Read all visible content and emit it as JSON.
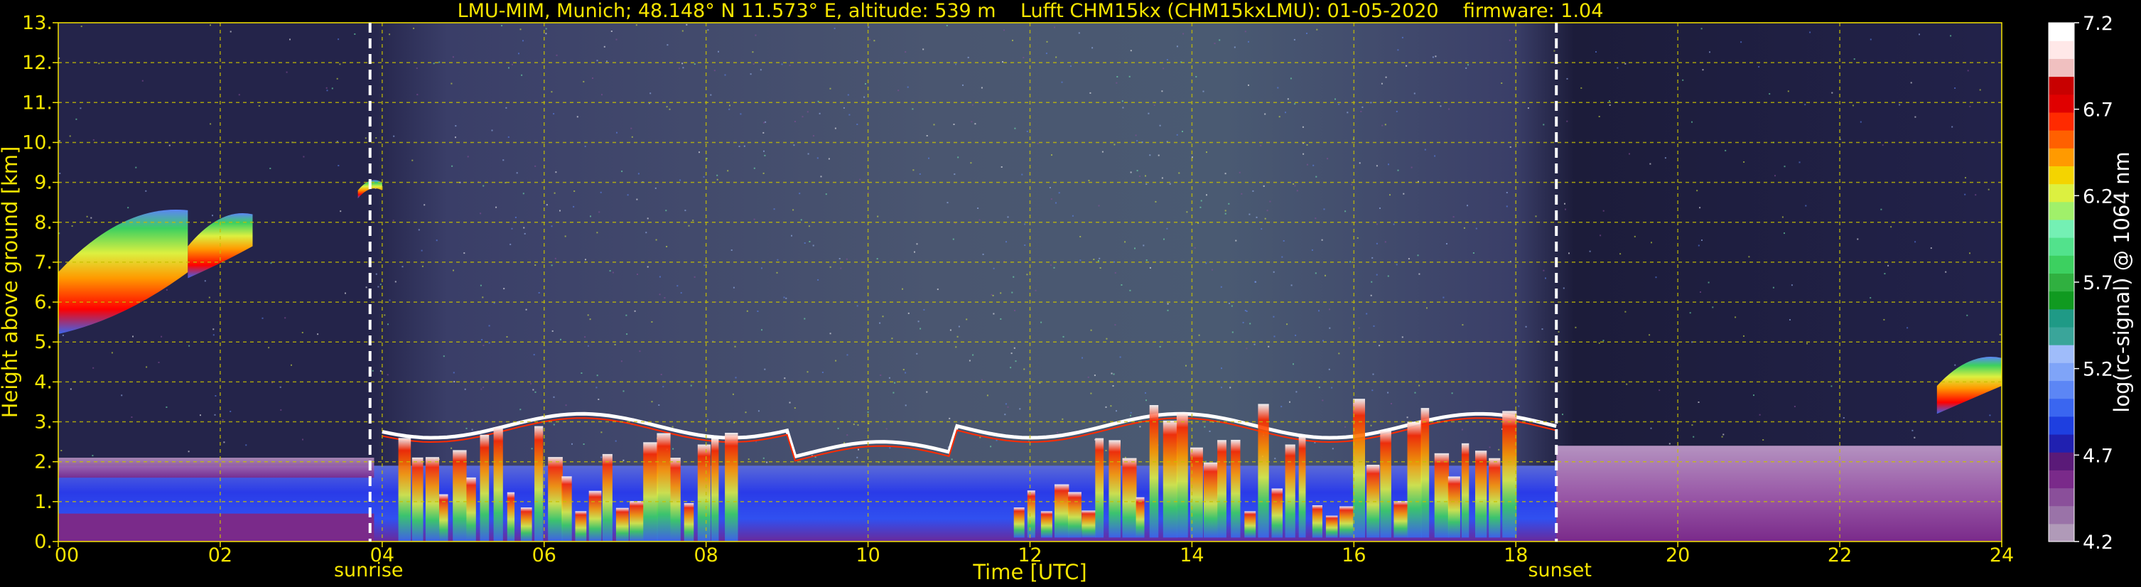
{
  "chart_data": {
    "type": "heatmap",
    "title": "LMU-MIM, Munich; 48.148° N 11.573° E, altitude: 539 m    Lufft CHM15kx (CHM15kxLMU): 01-05-2020    firmware: 1.04",
    "xlabel": "Time [UTC]",
    "ylabel": "Height above ground [km]",
    "xlim": [
      0,
      24
    ],
    "ylim": [
      0,
      13
    ],
    "x_ticks": [
      "00",
      "02",
      "04",
      "06",
      "08",
      "10",
      "12",
      "14",
      "16",
      "18",
      "20",
      "22",
      "24"
    ],
    "y_ticks": [
      "0.",
      "1.",
      "2.",
      "3.",
      "4.",
      "5.",
      "6.",
      "7.",
      "8.",
      "9.",
      "10.",
      "11.",
      "12.",
      "13."
    ],
    "grid": true,
    "markers": [
      {
        "label": "sunrise",
        "time": 3.85
      },
      {
        "label": "sunset",
        "time": 18.5
      }
    ],
    "colorbar": {
      "label": "log(rc-signal) @ 1064 nm",
      "range": [
        4.2,
        7.2
      ],
      "tick_labels": [
        "7.2",
        "6.7",
        "6.2",
        "5.7",
        "5.2",
        "4.7",
        "4.2"
      ],
      "colors": [
        "#b09ab8",
        "#9a73a8",
        "#8a4f9a",
        "#7a2a8a",
        "#5a1a78",
        "#2020b0",
        "#1e3fe0",
        "#3a66f0",
        "#5c86f5",
        "#7fa4f8",
        "#9fbcfa",
        "#3aa59a",
        "#1f9a86",
        "#109a20",
        "#30b040",
        "#3cd060",
        "#52e28c",
        "#74f0b4",
        "#a0f06a",
        "#dcf040",
        "#f4d400",
        "#ff9a00",
        "#ff6000",
        "#ff2a00",
        "#e00000",
        "#c80000",
        "#f0c0c0",
        "#ffe8e8",
        "#ffffff"
      ]
    },
    "features": [
      {
        "kind": "aerosol_layer",
        "t_start": 0.0,
        "t_end": 24.0,
        "bottom_km": 0.0,
        "top_km": 1.9
      },
      {
        "kind": "boundary_layer_top",
        "t_start": 4.0,
        "t_end": 18.5,
        "height_km": 2.9
      },
      {
        "kind": "cloud",
        "t_start": 0.0,
        "t_end": 1.6,
        "bottom_km": 5.2,
        "top_km": 8.3
      },
      {
        "kind": "cloud",
        "t_start": 1.6,
        "t_end": 2.4,
        "bottom_km": 6.6,
        "top_km": 8.2
      },
      {
        "kind": "cloud",
        "t_start": 3.7,
        "t_end": 4.0,
        "bottom_km": 8.6,
        "top_km": 9.0
      },
      {
        "kind": "convective_clouds",
        "t_start": 11.8,
        "t_end": 18.0,
        "bottom_km": 0.1,
        "top_km": 3.6
      },
      {
        "kind": "convective_clouds",
        "t_start": 4.2,
        "t_end": 8.4,
        "bottom_km": 0.0,
        "top_km": 3.0
      },
      {
        "kind": "cloud",
        "t_start": 23.2,
        "t_end": 24.0,
        "bottom_km": 3.2,
        "top_km": 4.6
      }
    ]
  }
}
